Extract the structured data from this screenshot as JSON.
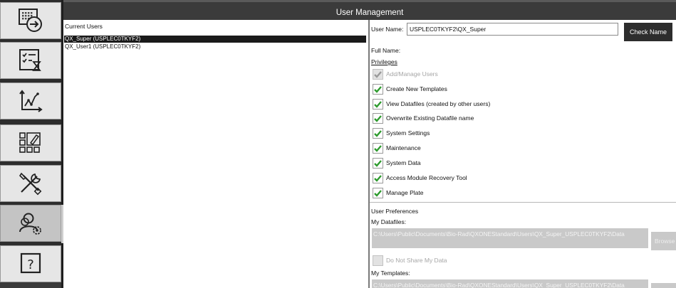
{
  "title": "User Management",
  "nav": [
    {
      "icon": "sign-in-icon",
      "active": false
    },
    {
      "icon": "checklist-timer-icon",
      "active": false
    },
    {
      "icon": "chart-analysis-icon",
      "active": false
    },
    {
      "icon": "layout-edit-icon",
      "active": false
    },
    {
      "icon": "tools-icon",
      "active": false
    },
    {
      "icon": "user-settings-icon",
      "active": true
    },
    {
      "icon": "help-icon",
      "active": false
    }
  ],
  "users": {
    "header": "Current Users",
    "items": [
      {
        "label": "QX_Super (USPLEC0TKYF2)",
        "selected": true
      },
      {
        "label": "QX_User1 (USPLEC0TKYF2)",
        "selected": false
      }
    ]
  },
  "details": {
    "user_name_label": "User Name:",
    "user_name_value": "USPLEC0TKYF2\\QX_Super",
    "check_name_label": "Check Name",
    "full_name_label": "Full Name:",
    "privileges_label": "Privileges",
    "privileges": [
      {
        "label": "Add/Manage Users",
        "checked": true,
        "disabled": true
      },
      {
        "label": "Create New Templates",
        "checked": true,
        "disabled": false
      },
      {
        "label": "View Datafiles (created by other users)",
        "checked": true,
        "disabled": false
      },
      {
        "label": "Overwrite Existing Datafile name",
        "checked": true,
        "disabled": false
      },
      {
        "label": "System Settings",
        "checked": true,
        "disabled": false
      },
      {
        "label": "Maintenance",
        "checked": true,
        "disabled": false
      },
      {
        "label": "System Data",
        "checked": true,
        "disabled": false
      },
      {
        "label": "Access Module Recovery Tool",
        "checked": true,
        "disabled": false
      },
      {
        "label": "Manage Plate",
        "checked": true,
        "disabled": false
      }
    ],
    "preferences_label": "User Preferences",
    "my_datafiles_label": "My Datafiles:",
    "my_datafiles_path": "C:\\Users\\Public\\Documents\\Bio-Rad\\QXONEStandard\\Users\\QX_Super_USPLEC0TKYF2\\Data",
    "browse_label": "Browse",
    "do_not_share_label": "Do Not Share My Data",
    "my_templates_label": "My Templates:",
    "my_templates_path": "C:\\Users\\Public\\Documents\\Bio-Rad\\QXONEStandard\\Users\\QX_Super_USPLEC0TKYF2\\Data"
  },
  "colors": {
    "rail": "#2d2d2d",
    "titlebar": "#3b3b3b",
    "selected_row": "#1a1a1a",
    "checkmark": "#2e9b2e",
    "disabled_field": "#c9c9c9"
  }
}
